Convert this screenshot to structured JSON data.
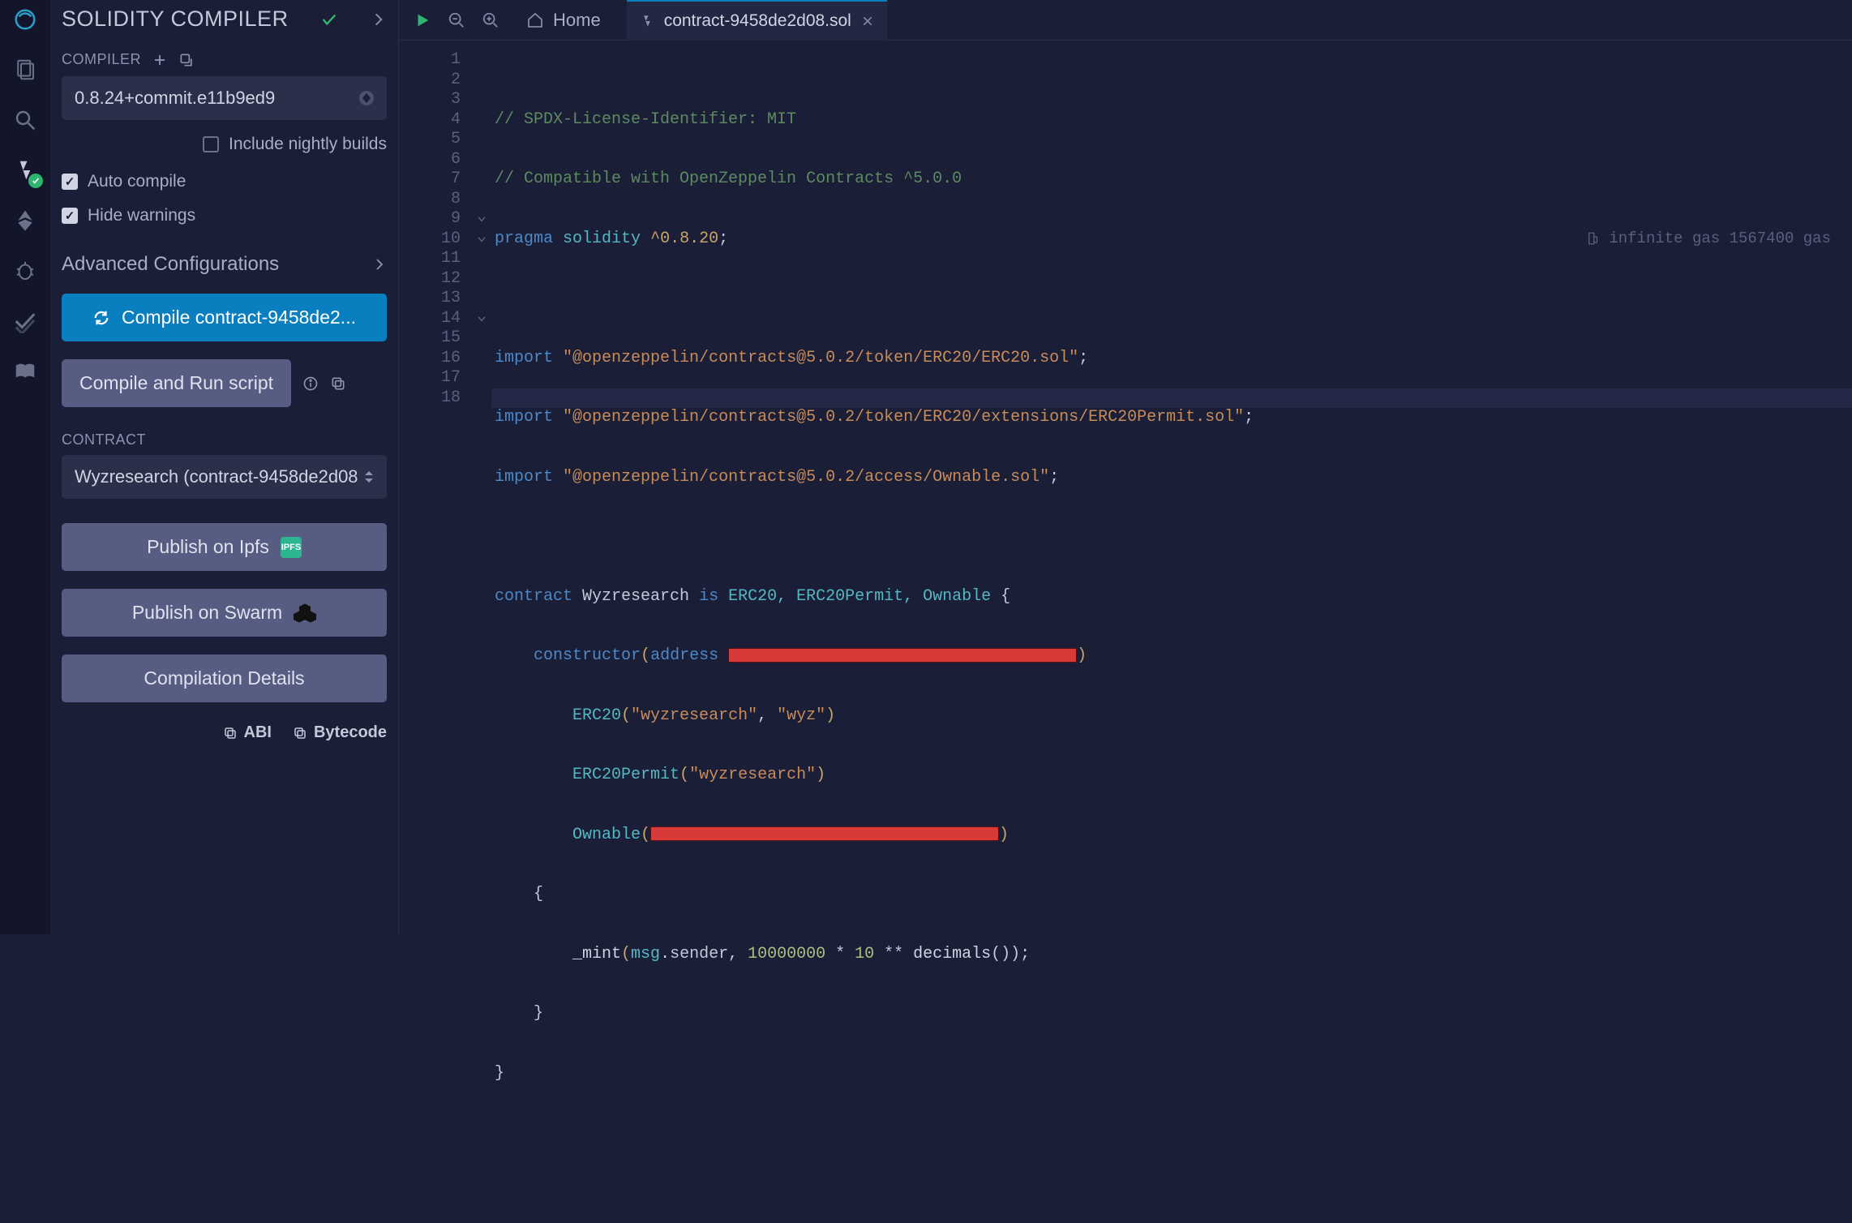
{
  "panel": {
    "title": "SOLIDITY COMPILER",
    "compiler_label": "COMPILER",
    "compiler_version": "0.8.24+commit.e11b9ed9",
    "nightly_label": "Include nightly builds",
    "auto_compile_label": "Auto compile",
    "hide_warnings_label": "Hide warnings",
    "advanced_label": "Advanced Configurations",
    "compile_btn": "Compile contract-9458de2...",
    "run_script_btn": "Compile and Run script",
    "contract_label": "CONTRACT",
    "contract_selected": "Wyzresearch (contract-9458de2d08",
    "publish_ipfs": "Publish on Ipfs",
    "publish_swarm": "Publish on Swarm",
    "compilation_details": "Compilation Details",
    "abi_label": "ABI",
    "bytecode_label": "Bytecode"
  },
  "tabs": {
    "home_label": "Home",
    "active_tab": "contract-9458de2d08.sol"
  },
  "gas_hint": "infinite gas 1567400 gas",
  "code": {
    "line1": "// SPDX-License-Identifier: MIT",
    "line2": "// Compatible with OpenZeppelin Contracts ^5.0.0",
    "line3_kw": "pragma",
    "line3_id": "solidity",
    "line3_ver": "^0.8.20",
    "line5_kw": "import",
    "line5_str": "\"@openzeppelin/contracts@5.0.2/token/ERC20/ERC20.sol\"",
    "line6_str": "\"@openzeppelin/contracts@5.0.2/token/ERC20/extensions/ERC20Permit.sol\"",
    "line7_str": "\"@openzeppelin/contracts@5.0.2/access/Ownable.sol\"",
    "line9_kw": "contract",
    "line9_name": "Wyzresearch",
    "line9_is": "is",
    "line9_inh": "ERC20, ERC20Permit, Ownable",
    "line10_kw": "constructor",
    "line10_type": "address",
    "line11_fn": "ERC20",
    "line11_a": "\"wyzresearch\"",
    "line11_b": "\"wyz\"",
    "line12_fn": "ERC20Permit",
    "line12_a": "\"wyzresearch\"",
    "line13_fn": "Ownable",
    "line15_fn": "_mint",
    "line15_msg": "msg",
    "line15_sender": ".sender, ",
    "line15_num1": "10000000",
    "line15_op": " * ",
    "line15_num2": "10",
    "line15_op2": " ** ",
    "line15_dec": "decimals",
    "line15_end": "());"
  },
  "line_numbers": [
    "1",
    "2",
    "3",
    "4",
    "5",
    "6",
    "7",
    "8",
    "9",
    "10",
    "11",
    "12",
    "13",
    "14",
    "15",
    "16",
    "17",
    "18"
  ]
}
